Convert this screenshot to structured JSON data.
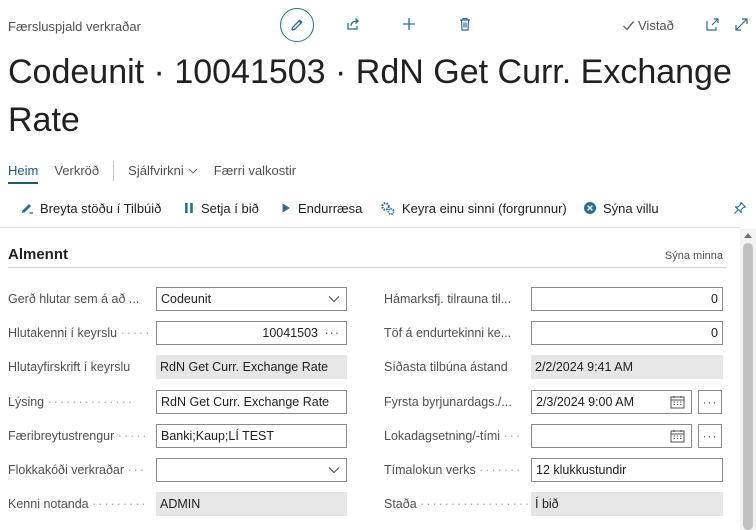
{
  "header": {
    "breadcrumb": "Færsluspjald verkraðar",
    "saved_label": "Vistað",
    "title": "Codeunit · 10041503 · RdN Get Curr. Exchange Rate"
  },
  "tabs": [
    {
      "label": "Heim"
    },
    {
      "label": "Verkröð"
    },
    {
      "label": "Sjálfvirkni"
    },
    {
      "label": "Færri valkostir"
    }
  ],
  "actions": [
    {
      "label": "Breyta stöðu í Tilbúið",
      "icon": "edit-status-icon"
    },
    {
      "label": "Setja í bið",
      "icon": "pause-icon"
    },
    {
      "label": "Endurræsa",
      "icon": "play-icon"
    },
    {
      "label": "Keyra einu sinni (forgrunnur)",
      "icon": "run-gears-icon"
    },
    {
      "label": "Sýna villu",
      "icon": "error-icon"
    }
  ],
  "section": {
    "title": "Almennt",
    "toggle": "Sýna minna"
  },
  "left_fields": [
    {
      "label": "Gerð hlutar sem á að ...",
      "value": "Codeunit"
    },
    {
      "label": "Hlutakenni í keyrslu",
      "value": "10041503"
    },
    {
      "label": "Hlutayfirskrift í keyrslu",
      "value": "RdN Get Curr. Exchange Rate"
    },
    {
      "label": "Lýsing",
      "value": "RdN Get Curr. Exchange Rate"
    },
    {
      "label": "Færibreytustrengur",
      "value": "Banki;Kaup;LÍ TEST"
    },
    {
      "label": "Flokkakóði verkraðar",
      "value": ""
    },
    {
      "label": "Kenni notanda",
      "value": "ADMIN"
    }
  ],
  "right_fields": [
    {
      "label": "Hámarksfj. tilrauna til...",
      "value": "0"
    },
    {
      "label": "Töf á endurtekinni ke...",
      "value": "0"
    },
    {
      "label": "Síðasta tilbúna ástand",
      "value": "2/2/2024 9:41 AM"
    },
    {
      "label": "Fyrsta byrjunardags./...",
      "value": "2/3/2024 9:00 AM"
    },
    {
      "label": "Lokadagsetning/-tími",
      "value": ""
    },
    {
      "label": "Tímalokun verks",
      "value": "12 klukkustundir"
    },
    {
      "label": "Staða",
      "value": "Í bið"
    }
  ],
  "colors": {
    "accent": "#1d5a78",
    "readonly_bg": "#e6e6e6",
    "border": "#8a8a8a"
  }
}
